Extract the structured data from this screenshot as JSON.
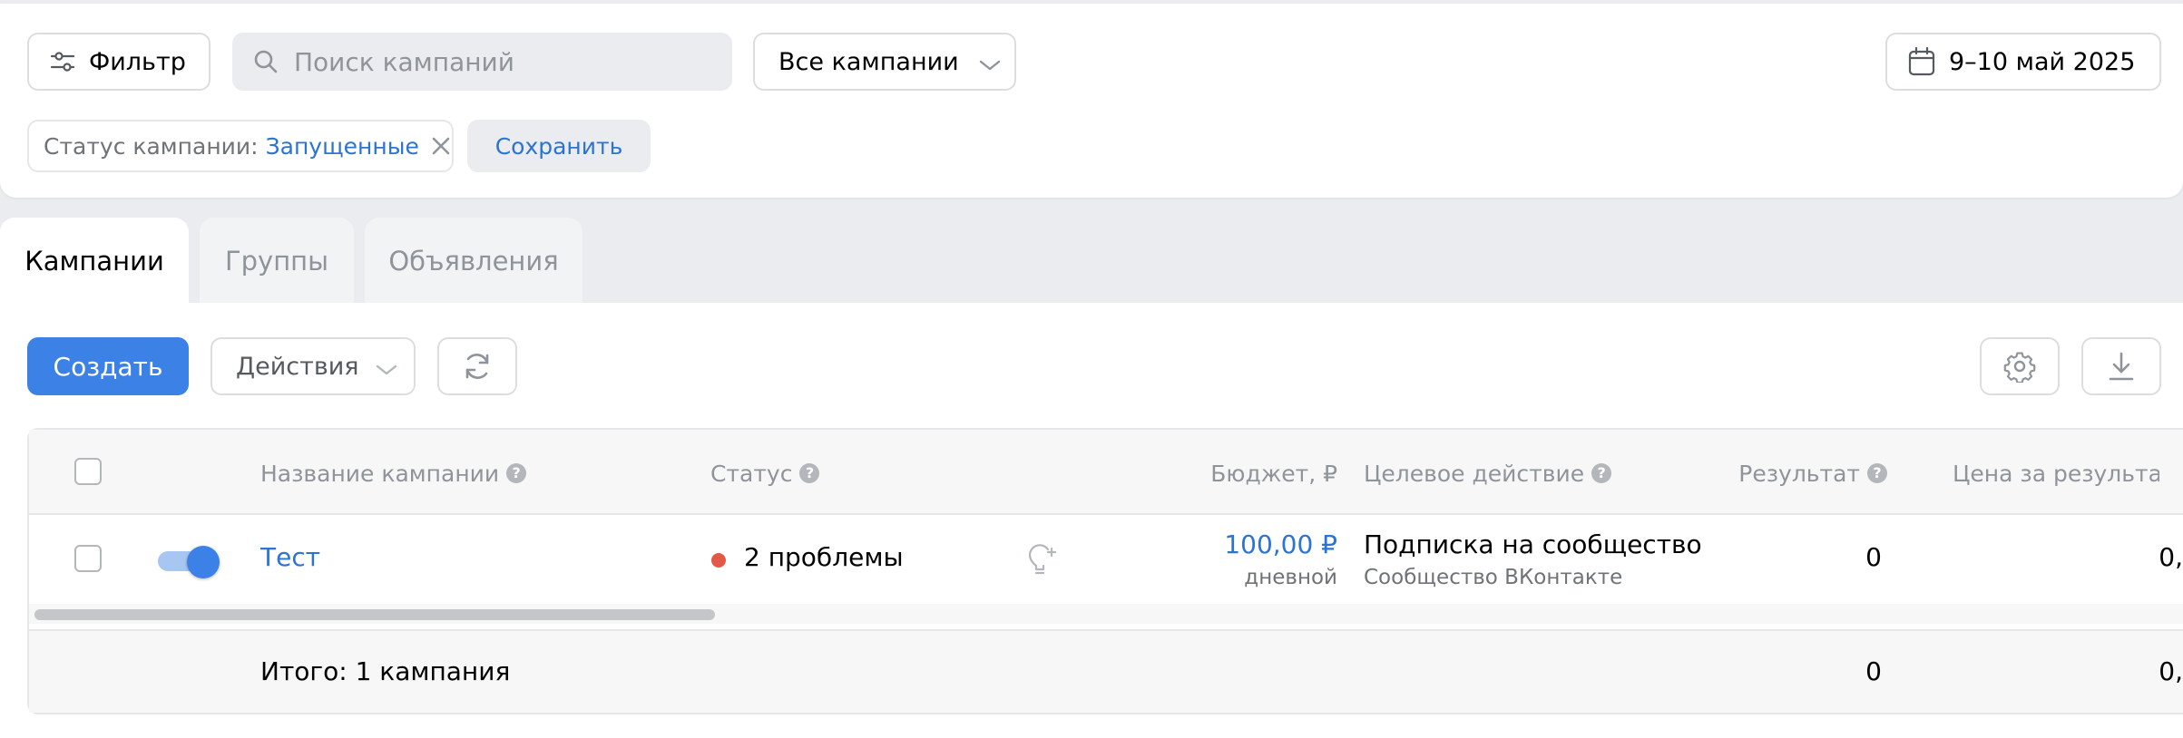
{
  "toolbar": {
    "filter_label": "Фильтр",
    "search_placeholder": "Поиск кампаний",
    "campaign_select": "Все кампании",
    "date_range": "9–10 май 2025"
  },
  "active_filter": {
    "label": "Статус кампании:",
    "value": "Запущенные",
    "save_label": "Сохранить"
  },
  "tabs": [
    {
      "label": "Кампании",
      "active": true
    },
    {
      "label": "Группы",
      "active": false
    },
    {
      "label": "Объявления",
      "active": false
    }
  ],
  "actions": {
    "create_label": "Создать",
    "actions_label": "Действия"
  },
  "table": {
    "columns": {
      "name": "Название кампании",
      "status": "Статус",
      "budget": "Бюджет, ₽",
      "target": "Целевое действие",
      "result": "Результат",
      "price": "Цена за результат"
    },
    "rows": [
      {
        "name": "Тест",
        "enabled": true,
        "status": "2 проблемы",
        "budget": "100,00 ₽",
        "budget_period": "дневной",
        "target": "Подписка на сообщество",
        "target_sub": "Сообщество ВКонтакте",
        "result": "0",
        "price": "0,"
      }
    ],
    "total": {
      "label": "Итого: 1 кампания",
      "result": "0",
      "price": "0,"
    }
  },
  "colors": {
    "accent": "#3c82e6",
    "link": "#2c74d3",
    "status_error": "#e05a47",
    "toggle_track": "#a8c6f2"
  }
}
